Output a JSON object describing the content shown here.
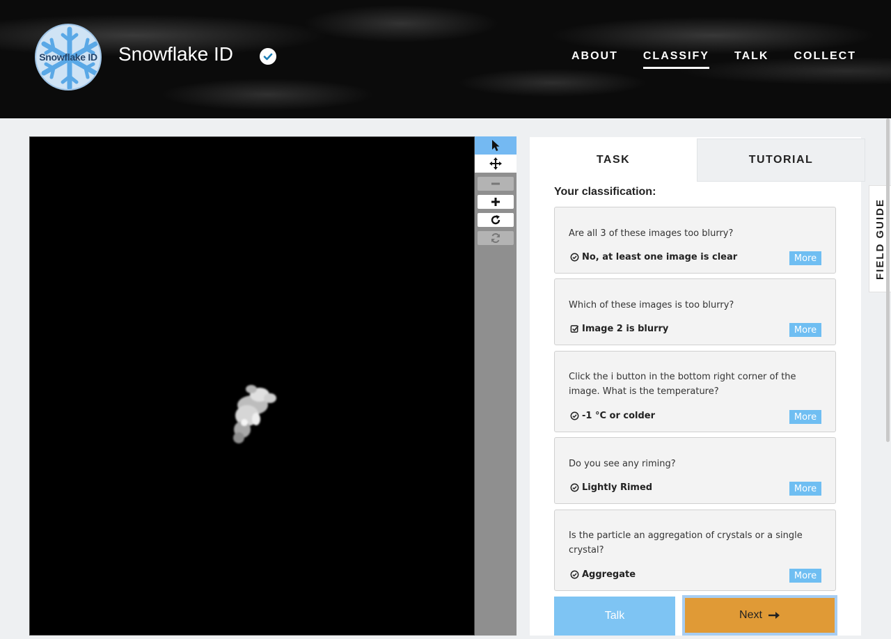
{
  "header": {
    "logo_text": "Snowflake ID",
    "project_title": "Snowflake ID",
    "nav": [
      {
        "label": "ABOUT"
      },
      {
        "label": "CLASSIFY"
      },
      {
        "label": "TALK"
      },
      {
        "label": "COLLECT"
      }
    ]
  },
  "toolbar": {
    "tools": [
      {
        "name": "pointer-tool",
        "icon": "cursor-arrow-icon",
        "state": "selected"
      },
      {
        "name": "pan-tool",
        "icon": "move-arrows-icon",
        "state": "enabled"
      },
      {
        "name": "zoom-out-tool",
        "icon": "minus-icon",
        "state": "disabled"
      },
      {
        "name": "zoom-in-tool",
        "icon": "plus-icon",
        "state": "enabled"
      },
      {
        "name": "rotate-tool",
        "icon": "rotate-icon",
        "state": "enabled"
      },
      {
        "name": "reset-tool",
        "icon": "refresh-icon",
        "state": "disabled"
      }
    ]
  },
  "panel": {
    "tabs": [
      {
        "label": "TASK"
      },
      {
        "label": "TUTORIAL"
      }
    ],
    "heading": "Your classification:",
    "answers": [
      {
        "question": "Are all 3 of these images too blurry?",
        "answer": "No, at least one image is clear",
        "icon": "circle-check-icon",
        "more": "More"
      },
      {
        "question": "Which of these images is too blurry?",
        "answer": "Image 2 is blurry",
        "icon": "checkbox-check-icon",
        "more": "More"
      },
      {
        "question": "Click the i button in the bottom right corner of the image. What is the temperature?",
        "answer": "-1 °C or colder",
        "icon": "circle-check-icon",
        "more": "More"
      },
      {
        "question": "Do you see any riming?",
        "answer": "Lightly Rimed",
        "icon": "circle-check-icon",
        "more": "More"
      },
      {
        "question": "Is the particle an aggregation of crystals or a single crystal?",
        "answer": "Aggregate",
        "icon": "circle-check-icon",
        "more": "More"
      }
    ],
    "talk_label": "Talk",
    "next_label": "Next"
  },
  "field_guide_label": "FIELD GUIDE",
  "colors": {
    "accent_blue": "#6fbef2",
    "next_orange": "#e09a36",
    "header_bg": "#0b0b0b"
  }
}
